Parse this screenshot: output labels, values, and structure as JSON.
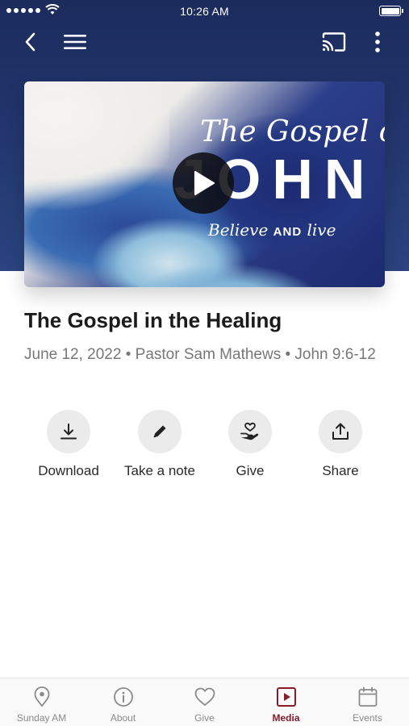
{
  "status_bar": {
    "time": "10:26 AM"
  },
  "hero": {
    "script_title": "The Gospel of",
    "big_title": "JOHN",
    "tagline_script_1": "Believe",
    "tagline_caps": "AND",
    "tagline_script_2": "live"
  },
  "sermon": {
    "title": "The Gospel in the Healing",
    "meta": "June 12, 2022 • Pastor Sam Mathews • John 9:6-12"
  },
  "actions": [
    {
      "label": "Download",
      "icon": "download-icon"
    },
    {
      "label": "Take a note",
      "icon": "pencil-icon"
    },
    {
      "label": "Give",
      "icon": "give-hand-heart-icon"
    },
    {
      "label": "Share",
      "icon": "share-icon"
    }
  ],
  "tabs": [
    {
      "label": "Sunday AM",
      "icon": "location-pin-icon",
      "active": false
    },
    {
      "label": "About",
      "icon": "info-icon",
      "active": false
    },
    {
      "label": "Give",
      "icon": "heart-icon",
      "active": false
    },
    {
      "label": "Media",
      "icon": "media-play-icon",
      "active": true
    },
    {
      "label": "Events",
      "icon": "calendar-icon",
      "active": false
    }
  ],
  "colors": {
    "header_bg": "#22356c",
    "accent_active_tab": "#8b1b2b",
    "action_circle": "#ebebeb"
  }
}
